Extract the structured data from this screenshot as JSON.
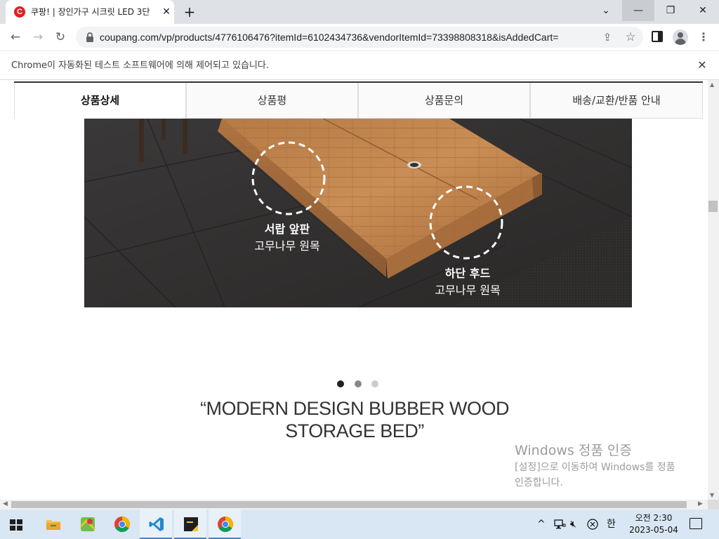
{
  "browser": {
    "tab_title": "쿠팡! | 장인가구 시크릿 LED 3단",
    "tab_favicon_letter": "C",
    "url": "coupang.com/vp/products/4776106476?itemId=6102434736&vendorItemId=73398808318&isAddedCart=",
    "infobar_message": "Chrome이 자동화된 테스트 소프트웨어에 의해 제어되고 있습니다."
  },
  "product_tabs": [
    {
      "label": "상품상세",
      "active": true
    },
    {
      "label": "상품평",
      "active": false
    },
    {
      "label": "상품문의",
      "active": false
    },
    {
      "label": "배송/교환/반품 안내",
      "active": false
    }
  ],
  "product_image": {
    "callout_1_title": "서랍 앞판",
    "callout_1_sub": "고무나무 원목",
    "callout_2_title": "하단 후드",
    "callout_2_sub": "고무나무 원목"
  },
  "carousel": {
    "count": 3,
    "active_index": 0
  },
  "headline": {
    "line1": "“MODERN DESIGN BUBBER WOOD",
    "line2": "STORAGE BED”"
  },
  "watermark": {
    "title": "Windows 정품 인증",
    "line1": "[설정]으로 이동하여 Windows를 정품",
    "line2": "인증합니다."
  },
  "taskbar": {
    "apps": [
      "file-explorer",
      "maps",
      "chrome",
      "vscode",
      "sticky-notes",
      "chrome-active"
    ],
    "ime": "한",
    "time": "오전 2:30",
    "date": "2023-05-04"
  }
}
